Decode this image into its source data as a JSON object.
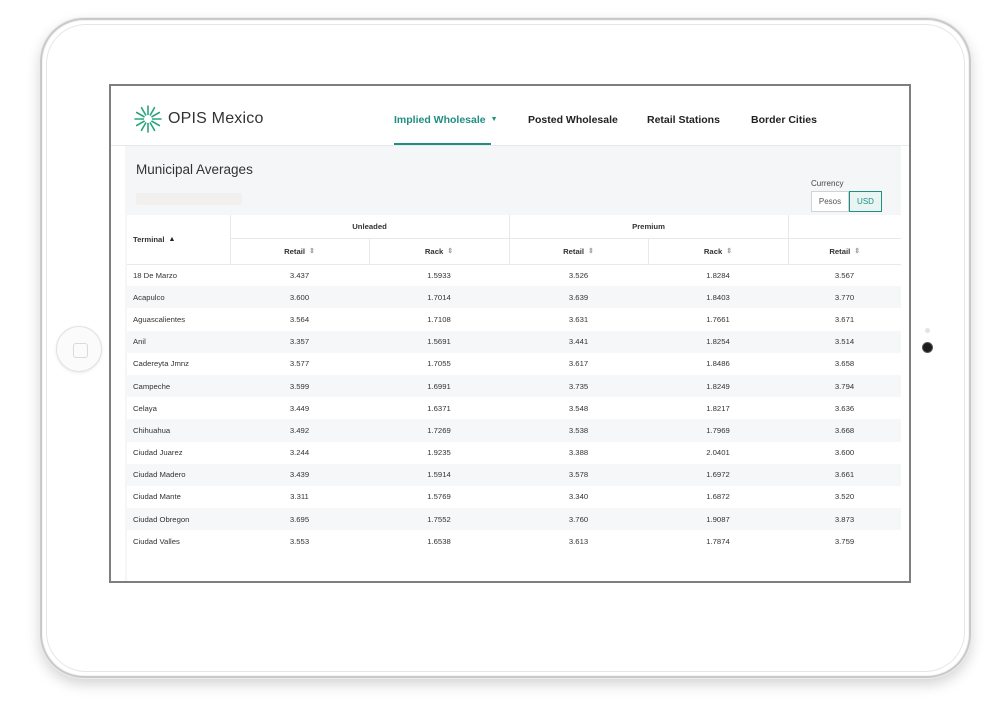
{
  "app": {
    "logo_text": "OPIS Mexico",
    "accent_color": "#1f8f82"
  },
  "nav": {
    "items": [
      {
        "label": "Implied Wholesale",
        "active": true,
        "has_dropdown": true
      },
      {
        "label": "Posted Wholesale"
      },
      {
        "label": "Retail Stations"
      },
      {
        "label": "Border Cities"
      }
    ]
  },
  "page": {
    "title": "Municipal Averages",
    "currency": {
      "label": "Currency",
      "options": [
        "Pesos",
        "USD"
      ],
      "selected": "USD"
    }
  },
  "table": {
    "terminal_header": "Terminal",
    "groups": [
      "Unleaded",
      "Premium"
    ],
    "subheaders": [
      "Retail",
      "Rack",
      "Retail",
      "Rack",
      "Retail"
    ],
    "rows": [
      [
        "18 De Marzo",
        "3.437",
        "1.5933",
        "3.526",
        "1.8284",
        "3.567"
      ],
      [
        "Acapulco",
        "3.600",
        "1.7014",
        "3.639",
        "1.8403",
        "3.770"
      ],
      [
        "Aguascalientes",
        "3.564",
        "1.7108",
        "3.631",
        "1.7661",
        "3.671"
      ],
      [
        "Anil",
        "3.357",
        "1.5691",
        "3.441",
        "1.8254",
        "3.514"
      ],
      [
        "Cadereyta Jmnz",
        "3.577",
        "1.7055",
        "3.617",
        "1.8486",
        "3.658"
      ],
      [
        "Campeche",
        "3.599",
        "1.6991",
        "3.735",
        "1.8249",
        "3.794"
      ],
      [
        "Celaya",
        "3.449",
        "1.6371",
        "3.548",
        "1.8217",
        "3.636"
      ],
      [
        "Chihuahua",
        "3.492",
        "1.7269",
        "3.538",
        "1.7969",
        "3.668"
      ],
      [
        "Ciudad Juarez",
        "3.244",
        "1.9235",
        "3.388",
        "2.0401",
        "3.600"
      ],
      [
        "Ciudad Madero",
        "3.439",
        "1.5914",
        "3.578",
        "1.6972",
        "3.661"
      ],
      [
        "Ciudad Mante",
        "3.311",
        "1.5769",
        "3.340",
        "1.6872",
        "3.520"
      ],
      [
        "Ciudad Obregon",
        "3.695",
        "1.7552",
        "3.760",
        "1.9087",
        "3.873"
      ],
      [
        "Ciudad Valles",
        "3.553",
        "1.6538",
        "3.613",
        "1.7874",
        "3.759"
      ]
    ]
  }
}
